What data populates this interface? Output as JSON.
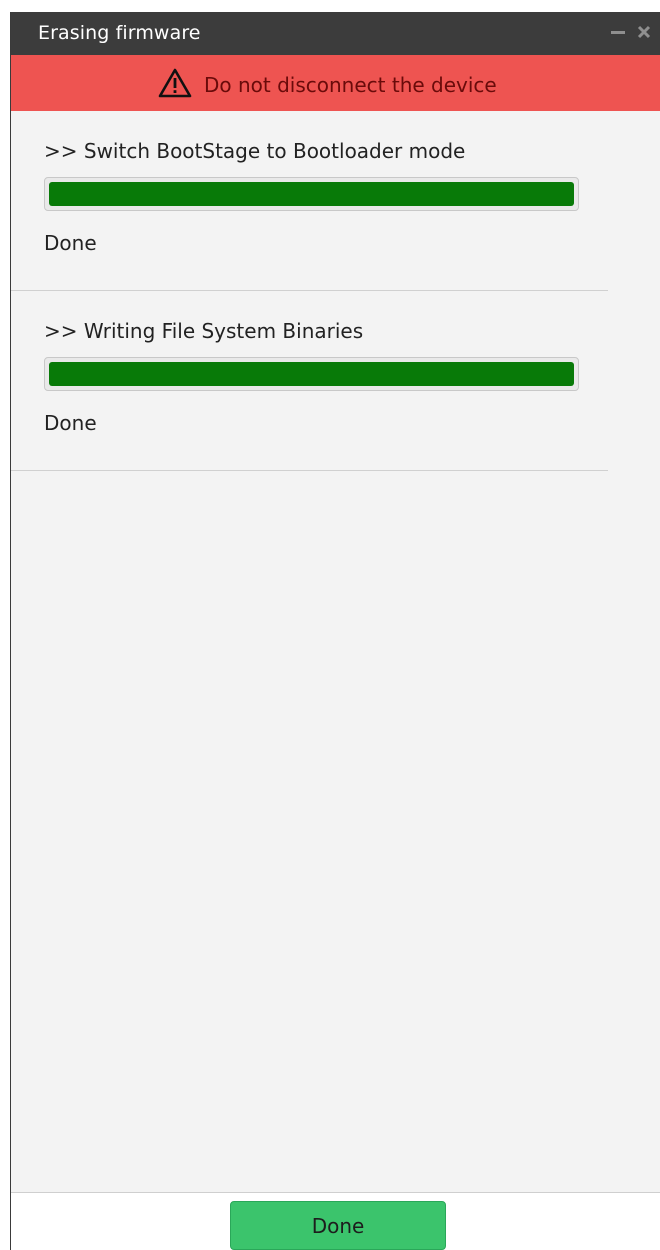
{
  "window": {
    "title": "Erasing firmware",
    "controls": {
      "minimize_icon": "minimize-icon",
      "close_icon": "close-icon"
    }
  },
  "warning": {
    "icon": "warning-triangle-icon",
    "text": "Do not disconnect the device",
    "color": "#ee5451"
  },
  "steps": [
    {
      "title": ">> Switch BootStage to Bootloader mode",
      "progress": 1.0,
      "status": "Done"
    },
    {
      "title": ">> Writing File System Binaries",
      "progress": 1.0,
      "status": "Done"
    }
  ],
  "progress_color": "#087a08",
  "footer": {
    "done_label": "Done",
    "done_color": "#3bc46c"
  }
}
